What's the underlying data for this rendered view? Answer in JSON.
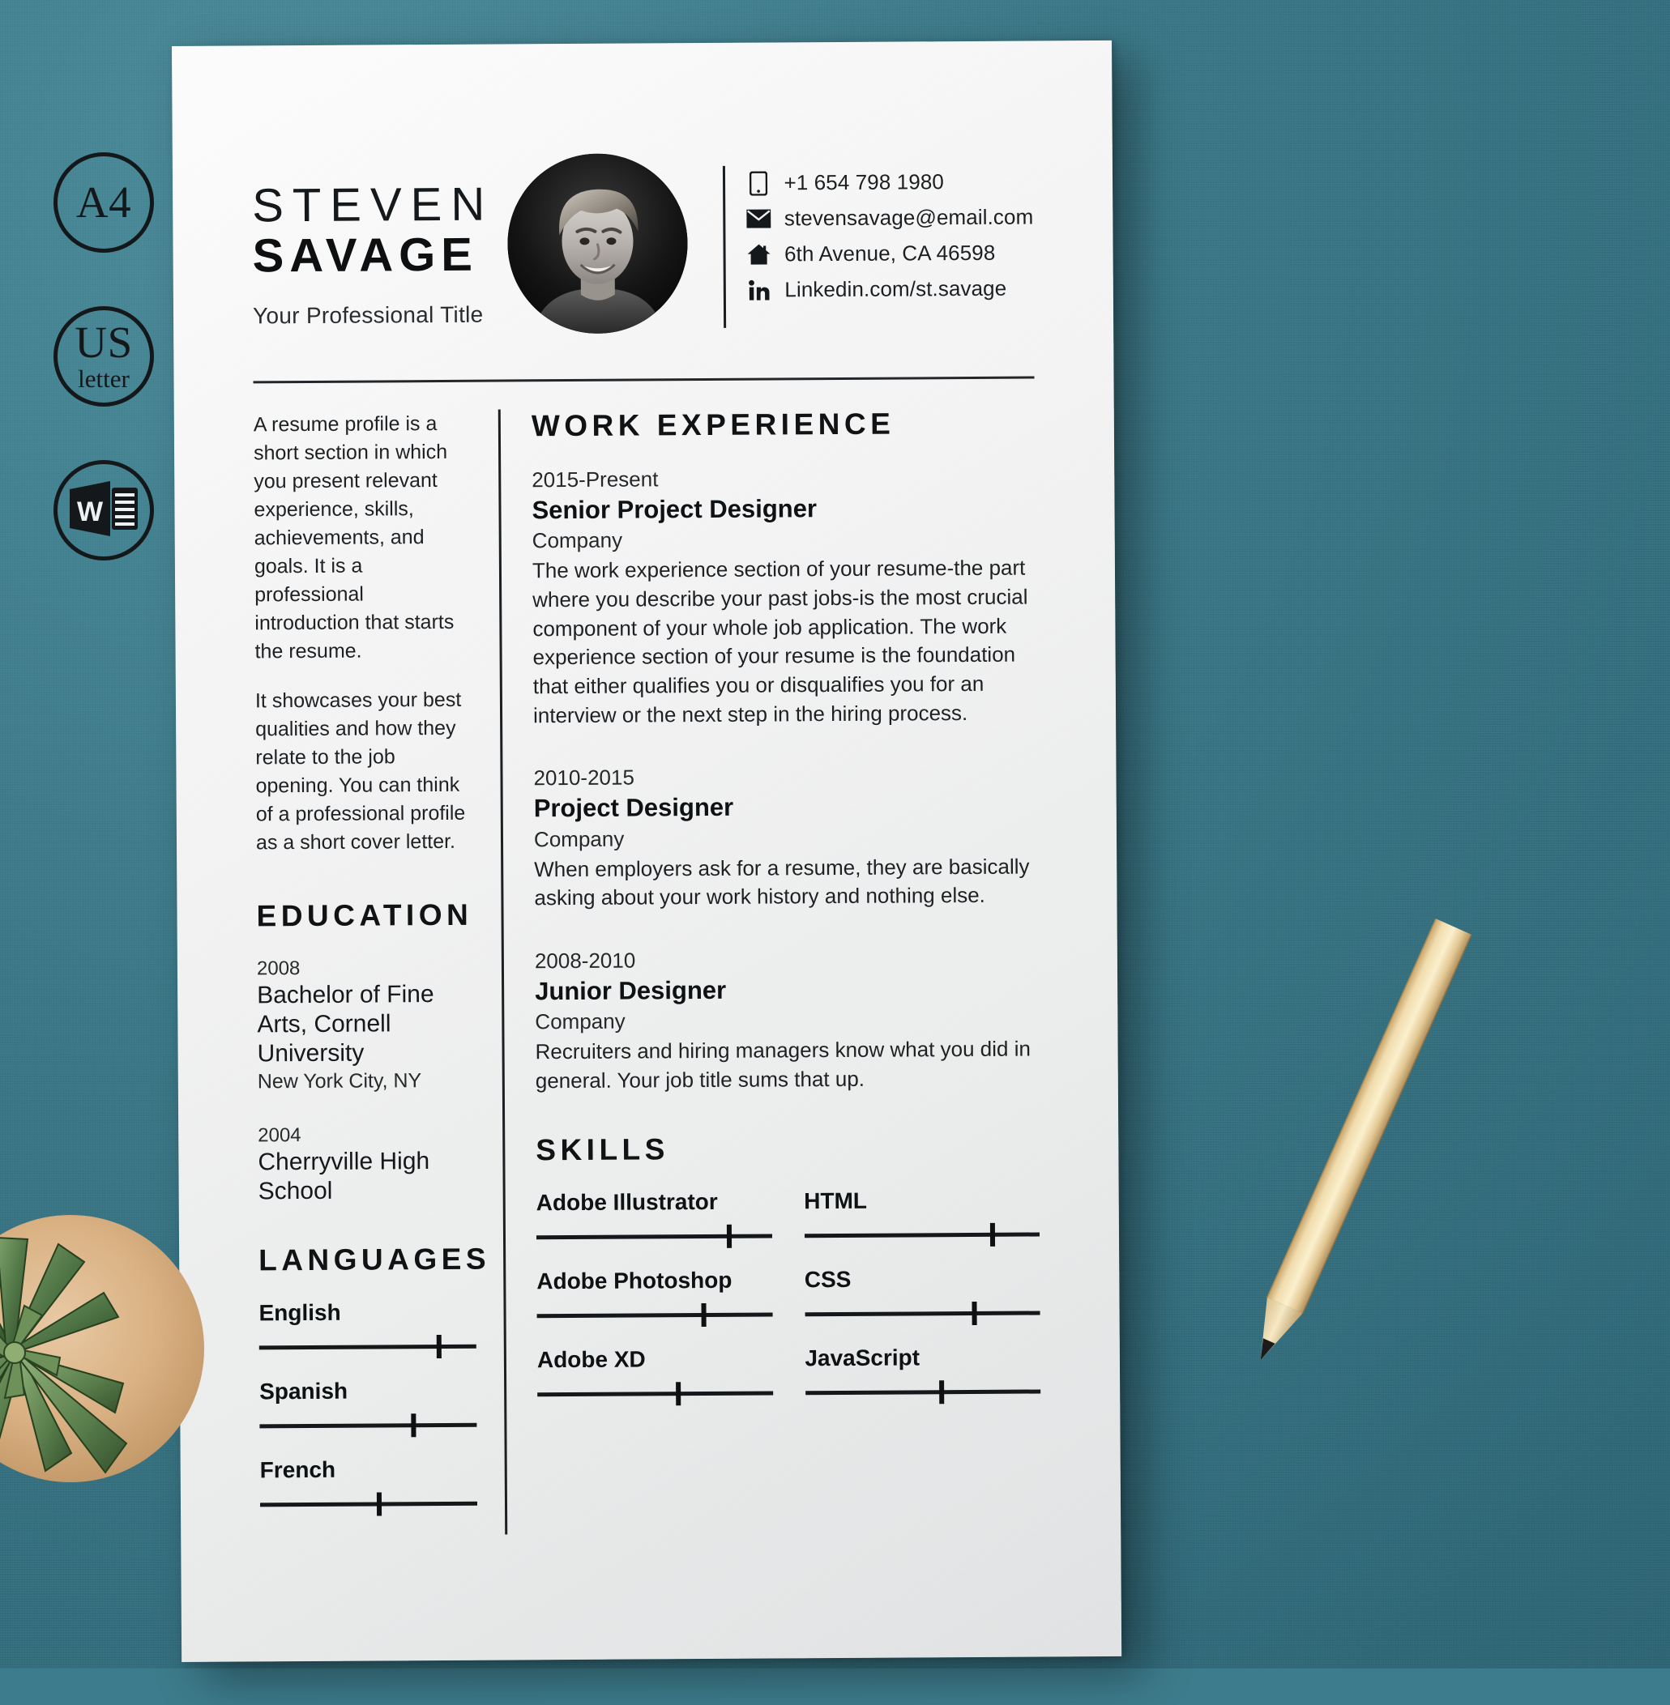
{
  "badges": [
    {
      "name": "a4-badge",
      "main": "A4",
      "sub": ""
    },
    {
      "name": "us-letter-badge",
      "main": "US",
      "sub": "letter"
    },
    {
      "name": "word-badge",
      "main": "W",
      "sub": ""
    }
  ],
  "header": {
    "first_name": "STEVEN",
    "last_name": "SAVAGE",
    "job_title": "Your Professional Title",
    "photo_alt": "profile-photo"
  },
  "contact": [
    {
      "icon": "phone-icon",
      "text": "+1 654 798 1980"
    },
    {
      "icon": "envelope-icon",
      "text": "stevensavage@email.com"
    },
    {
      "icon": "home-icon",
      "text": "6th Avenue, CA 46598"
    },
    {
      "icon": "linkedin-icon",
      "text": "Linkedin.com/st.savage"
    }
  ],
  "profile": {
    "paragraphs": [
      "A resume profile is a short section in which you present relevant experience, skills, achievements, and goals. It is a professional introduction that starts the resume.",
      "It showcases your best qualities and how they relate to the job opening. You can think of a professional profile as a short cover letter."
    ]
  },
  "education": {
    "title": "EDUCATION",
    "items": [
      {
        "year": "2008",
        "degree": "Bachelor of Fine Arts, Cornell University",
        "location": "New York City, NY"
      },
      {
        "year": "2004",
        "degree": "Cherryville High School",
        "location": ""
      }
    ]
  },
  "work": {
    "title": "WORK EXPERIENCE",
    "jobs": [
      {
        "years": "2015-Present",
        "role": "Senior Project Designer",
        "company": "Company",
        "description": "The work experience section of your resume-the part where you describe your past jobs-is the most crucial component of your whole job application. The work experience section of your resume is the foundation that either qualifies you or disqualifies you for an interview or the next step in the hiring process."
      },
      {
        "years": "2010-2015",
        "role": "Project Designer",
        "company": "Company",
        "description": "When employers ask for a resume, they are basically asking about your work history and nothing else."
      },
      {
        "years": "2008-2010",
        "role": "Junior Designer",
        "company": "Company",
        "description": "Recruiters and hiring managers know what you did in general. Your job title sums that up."
      }
    ]
  },
  "languages": {
    "title": "LANGUAGES",
    "items": [
      {
        "label": "English",
        "level": 83
      },
      {
        "label": "Spanish",
        "level": 71
      },
      {
        "label": "French",
        "level": 55
      }
    ]
  },
  "skills": {
    "title": "SKILLS",
    "column_one": [
      {
        "label": "Adobe Illustrator",
        "level": 82
      },
      {
        "label": "Adobe Photoshop",
        "level": 71
      },
      {
        "label": "Adobe XD",
        "level": 60
      }
    ],
    "column_two": [
      {
        "label": "HTML",
        "level": 80
      },
      {
        "label": "CSS",
        "level": 72
      },
      {
        "label": "JavaScript",
        "level": 58
      }
    ]
  },
  "colors": {
    "background": "#3d7c8c",
    "paper": "#f3f3f4",
    "ink": "#14181a"
  }
}
